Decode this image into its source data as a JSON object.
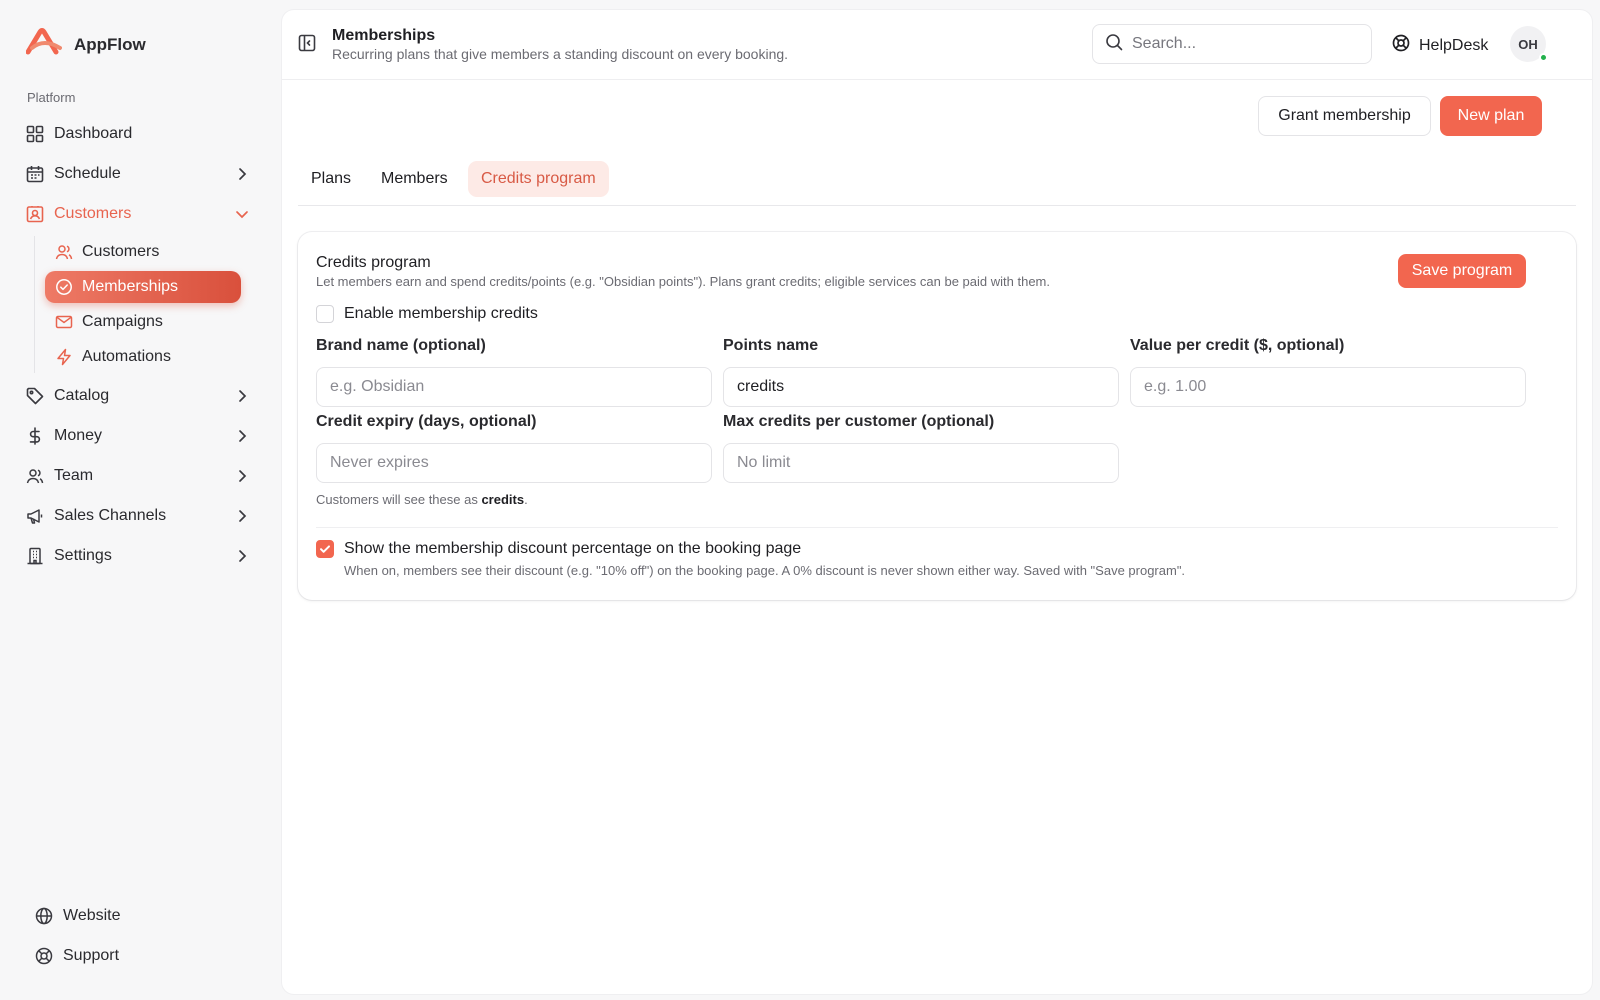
{
  "app": {
    "name": "AppFlow",
    "brand_color": "#f2664f"
  },
  "sidebar": {
    "section_label": "Platform",
    "items": [
      {
        "label": "Dashboard",
        "icon": "dashboard-grid-icon"
      },
      {
        "label": "Schedule",
        "icon": "calendar-icon"
      },
      {
        "label": "Customers",
        "icon": "customer-badge-icon",
        "expanded": true,
        "children": [
          {
            "label": "Customers",
            "icon": "users-icon"
          },
          {
            "label": "Memberships",
            "icon": "badge-check-icon",
            "active": true
          },
          {
            "label": "Campaigns",
            "icon": "mail-icon"
          },
          {
            "label": "Automations",
            "icon": "lightning-icon"
          }
        ]
      },
      {
        "label": "Catalog",
        "icon": "tag-icon"
      },
      {
        "label": "Money",
        "icon": "dollar-icon"
      },
      {
        "label": "Team",
        "icon": "team-icon"
      },
      {
        "label": "Sales Channels",
        "icon": "megaphone-icon"
      },
      {
        "label": "Settings",
        "icon": "settings-building-icon"
      }
    ],
    "footer": [
      {
        "label": "Website",
        "icon": "globe-icon"
      },
      {
        "label": "Support",
        "icon": "lifebuoy-icon"
      }
    ]
  },
  "header": {
    "title": "Memberships",
    "subtitle": "Recurring plans that give members a standing discount on every booking.",
    "search_placeholder": "Search...",
    "helpdesk_label": "HelpDesk",
    "avatar_initials": "OH",
    "online_status_color": "#22b14c"
  },
  "actions": {
    "grant_label": "Grant membership",
    "new_plan_label": "New plan"
  },
  "tabs": [
    {
      "label": "Plans",
      "active": false
    },
    {
      "label": "Members",
      "active": false
    },
    {
      "label": "Credits program",
      "active": true
    }
  ],
  "credits": {
    "title": "Credits program",
    "description": "Let members earn and spend credits/points (e.g. \"Obsidian points\"). Plans grant credits; eligible services can be paid with them.",
    "save_label": "Save program",
    "enable_label": "Enable membership credits",
    "enable_checked": false,
    "fields": {
      "brand_name": {
        "label": "Brand name (optional)",
        "placeholder": "e.g. Obsidian",
        "value": ""
      },
      "points_name": {
        "label": "Points name",
        "placeholder": "",
        "value": "credits"
      },
      "value_per_credit": {
        "label": "Value per credit ($, optional)",
        "placeholder": "e.g. 1.00",
        "value": ""
      },
      "credit_expiry": {
        "label": "Credit expiry (days, optional)",
        "placeholder": "Never expires",
        "value": ""
      },
      "max_credits": {
        "label": "Max credits per customer (optional)",
        "placeholder": "No limit",
        "value": ""
      }
    },
    "hint_prefix": "Customers will see these as ",
    "hint_term": "credits",
    "hint_suffix": ".",
    "discount_label": "Show the membership discount percentage on the booking page",
    "discount_checked": true,
    "discount_description": "When on, members see their discount (e.g. \"10% off\") on the booking page. A 0% discount is never shown either way. Saved with \"Save program\"."
  }
}
